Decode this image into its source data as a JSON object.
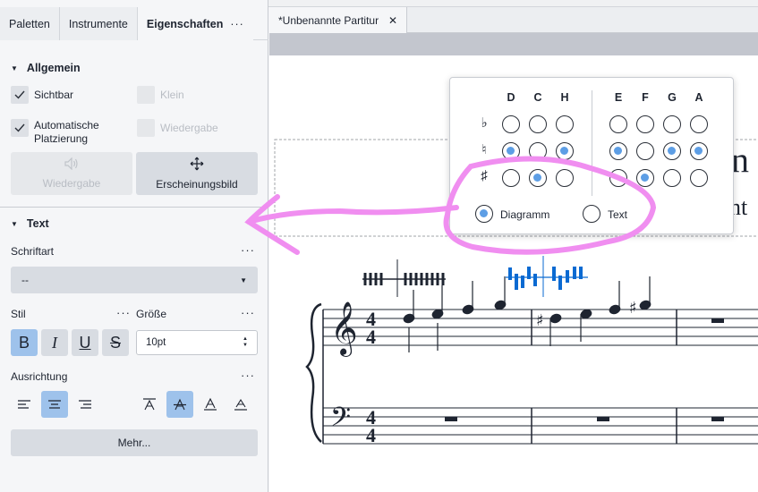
{
  "panel": {
    "tabs": [
      "Paletten",
      "Instrumente",
      "Eigenschaften"
    ],
    "tab_more": "···",
    "general": {
      "title": "Allgemein",
      "visible_label": "Sichtbar",
      "small_label": "Klein",
      "auto_place_line1": "Automatische",
      "auto_place_line2": "Platzierung",
      "playback_chk_label": "Wiedergabe",
      "playback_btn_label": "Wiedergabe",
      "appearance_btn_label": "Erscheinungsbild"
    },
    "text": {
      "title": "Text",
      "font_label": "Schriftart",
      "font_value": "--",
      "style_label": "Stil",
      "size_label": "Größe",
      "size_value": "10pt",
      "bold": "B",
      "italic": "I",
      "underline": "U",
      "strike": "S",
      "alignment_label": "Ausrichtung",
      "more_button": "Mehr..."
    },
    "more_dots": "···"
  },
  "document": {
    "tab_title": "*Unbenannte Partitur",
    "close_glyph": "✕"
  },
  "popup": {
    "left_headers": [
      "D",
      "C",
      "H"
    ],
    "right_headers": [
      "E",
      "F",
      "G",
      "A"
    ],
    "accidentals": [
      "♭",
      "♮",
      "♯"
    ],
    "left_state": [
      [
        false,
        false,
        false
      ],
      [
        true,
        false,
        true
      ],
      [
        false,
        true,
        false
      ]
    ],
    "right_state": [
      [
        false,
        false,
        false,
        false
      ],
      [
        true,
        false,
        true,
        true
      ],
      [
        false,
        true,
        false,
        false
      ]
    ],
    "diagram_label": "Diagramm",
    "text_label": "Text",
    "selected_option": "Diagramm"
  },
  "score": {
    "time_signature": "4/4",
    "title_fragment": "nn",
    "subtitle_fragment": "nt"
  },
  "colors": {
    "accent": "#5d9ee5",
    "active_button": "#9ec2eb",
    "selection_blue": "#0a6ad2",
    "annotation_pink": "#f08ef0"
  }
}
